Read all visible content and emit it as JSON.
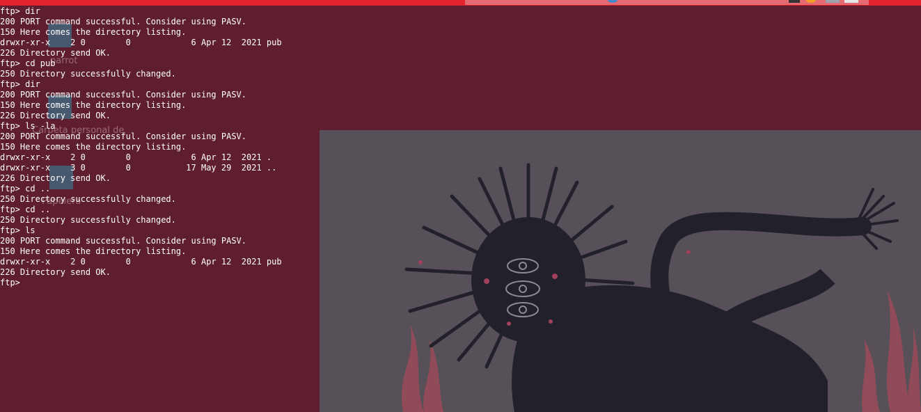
{
  "terminal": {
    "lines": [
      "ftp> dir",
      "200 PORT command successful. Consider using PASV.",
      "150 Here comes the directory listing.",
      "drwxr-xr-x    2 0        0            6 Apr 12  2021 pub",
      "226 Directory send OK.",
      "ftp> cd pub",
      "250 Directory successfully changed.",
      "ftp> dir",
      "200 PORT command successful. Consider using PASV.",
      "150 Here comes the directory listing.",
      "226 Directory send OK.",
      "ftp> ls -la",
      "200 PORT command successful. Consider using PASV.",
      "150 Here comes the directory listing.",
      "drwxr-xr-x    2 0        0            6 Apr 12  2021 .",
      "drwxr-xr-x    3 0        0           17 May 29  2021 ..",
      "226 Directory send OK.",
      "ftp> cd ..",
      "250 Directory successfully changed.",
      "ftp> cd ..",
      "250 Directory successfully changed.",
      "ftp> ls",
      "200 PORT command successful. Consider using PASV.",
      "150 Here comes the directory listing.",
      "drwxr-xr-x    2 0        0            6 Apr 12  2021 pub",
      "226 Directory send OK.",
      "ftp> "
    ]
  },
  "desktop": {
    "icons": [
      {
        "label": "parrot",
        "icon": "computer-icon"
      },
      {
        "label": "Carpeta personal de",
        "icon": "home-folder-icon"
      },
      {
        "label": "Papelera",
        "icon": "trash-icon"
      }
    ]
  },
  "panel": {
    "tray_icons": [
      "globe-icon",
      "terminal-icon",
      "firefox-icon",
      "files-icon",
      "window-icon"
    ]
  },
  "colors": {
    "terminal_bg": "#5e1e2f",
    "terminal_fg": "#ffffff",
    "panel": "#e0232d",
    "wallpaper_bg": "#585059",
    "creature": "#22202b",
    "flames": "#a8505e"
  }
}
